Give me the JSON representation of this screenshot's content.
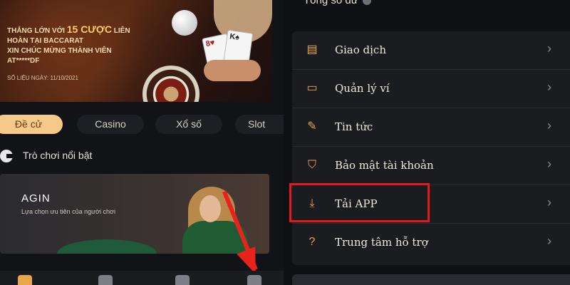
{
  "banner": {
    "line1_pre": "THẮNG LỚN VỚI",
    "line1_hl": "15 CƯỢC",
    "line1_post": "LIÊN",
    "line2": "HOÀN TẠI BACCARAT",
    "line3": "XIN CHÚC MỪNG THÀNH VIÊN",
    "line4": "AT*****DF",
    "date": "SỐ LIỆU NGÀY: 11/10/2021",
    "card1": "8♥",
    "card2": "K♠"
  },
  "tabs": [
    {
      "label": "Đề cử",
      "active": true
    },
    {
      "label": "Casino"
    },
    {
      "label": "Xổ số"
    },
    {
      "label": "Slot"
    }
  ],
  "featured": {
    "label": "Trò chơi nổi bật"
  },
  "game_card": {
    "title": "AGIN",
    "subtitle": "Lựa chọn ưu tiên của người chơi"
  },
  "balance": {
    "label": "Tổng số dư"
  },
  "menu": [
    {
      "label": "Giao dịch",
      "icon": "receipt-icon"
    },
    {
      "label": "Quản lý ví",
      "icon": "wallet-icon"
    },
    {
      "label": "Tin tức",
      "icon": "news-icon"
    },
    {
      "label": "Bảo mật tài khoản",
      "icon": "shield-icon"
    },
    {
      "label": "Tải APP",
      "icon": "download-icon"
    },
    {
      "label": "Trung tâm hỗ trợ",
      "icon": "help-icon"
    }
  ],
  "colors": {
    "accent": "#eaa552",
    "active_tab": "#f4c98a",
    "highlight": "#e3191b",
    "panel": "#1b1c20"
  }
}
